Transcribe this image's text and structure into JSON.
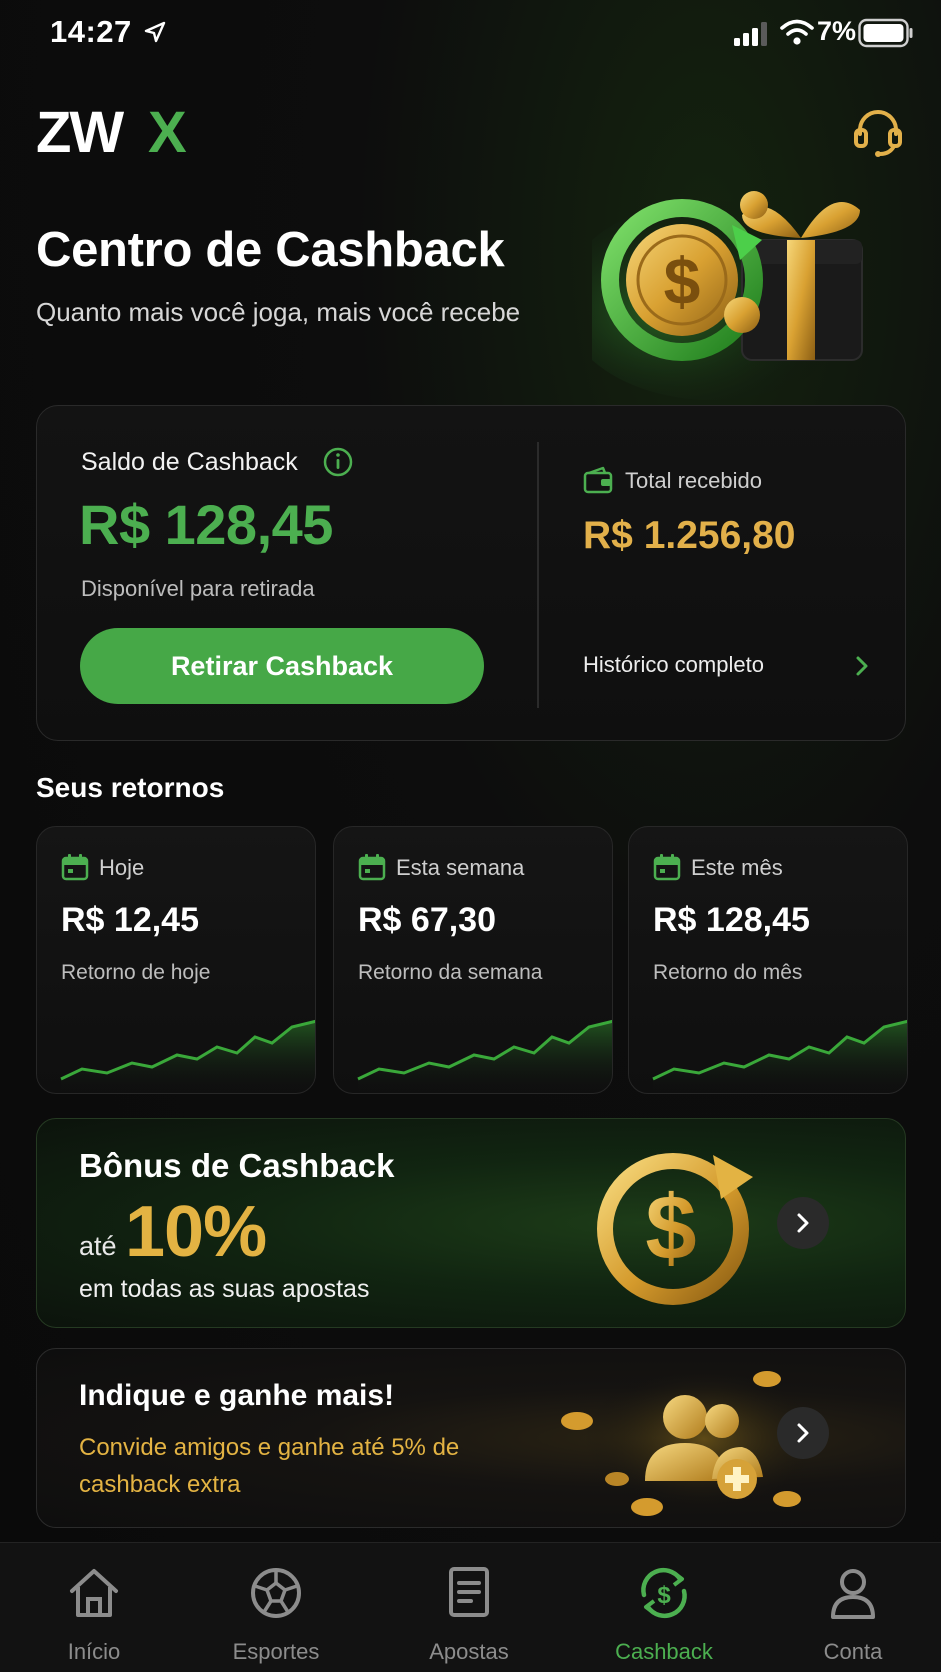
{
  "status_bar": {
    "time": "14:27",
    "battery": "7%"
  },
  "header": {
    "logo_text_white": "ZW",
    "logo_text_green": "X"
  },
  "hero": {
    "title": "Centro de Cashback",
    "subtitle": "Quanto mais você joga, mais você recebe"
  },
  "balance_card": {
    "label": "Saldo de Cashback",
    "value": "R$ 128,45",
    "caption": "Disponível para retirada",
    "withdraw_label": "Retirar Cashback",
    "total_label": "Total recebido",
    "total_value": "R$ 1.256,80",
    "history_label": "Histórico completo"
  },
  "returns": {
    "title": "Seus retornos",
    "cards": [
      {
        "label": "Hoje",
        "value": "R$ 12,45",
        "caption": "Retorno de hoje"
      },
      {
        "label": "Esta semana",
        "value": "R$ 67,30",
        "caption": "Retorno da semana"
      },
      {
        "label": "Este mês",
        "value": "R$ 128,45",
        "caption": "Retorno do mês"
      }
    ]
  },
  "bonus": {
    "title": "Bônus de Cashback",
    "prefix": "até",
    "percent": "10%",
    "subtitle": "em todas as suas apostas"
  },
  "refer": {
    "title": "Indique e ganhe mais!",
    "subtitle": "Convide amigos e ganhe até 5% de cashback extra"
  },
  "tabs": [
    {
      "label": "Início",
      "icon": "home-icon"
    },
    {
      "label": "Esportes",
      "icon": "ball-icon"
    },
    {
      "label": "Apostas",
      "icon": "ticket-icon"
    },
    {
      "label": "Cashback",
      "icon": "cashback-icon",
      "active": true
    },
    {
      "label": "Conta",
      "icon": "user-icon"
    }
  ],
  "colors": {
    "green": "#4caf50",
    "gold": "#e2b04a",
    "background": "#0b0b0b"
  }
}
